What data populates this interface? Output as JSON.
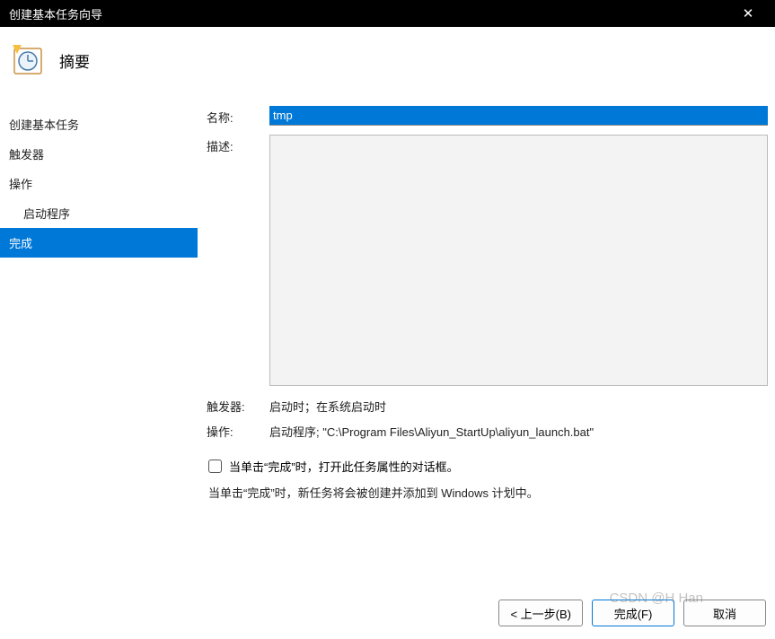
{
  "window": {
    "title": "创建基本任务向导"
  },
  "header": {
    "title": "摘要"
  },
  "sidebar": {
    "items": [
      {
        "label": "创建基本任务",
        "indent": false,
        "selected": false
      },
      {
        "label": "触发器",
        "indent": false,
        "selected": false
      },
      {
        "label": "操作",
        "indent": false,
        "selected": false
      },
      {
        "label": "启动程序",
        "indent": true,
        "selected": false
      },
      {
        "label": "完成",
        "indent": false,
        "selected": true
      }
    ]
  },
  "form": {
    "name_label": "名称:",
    "name_value": "tmp",
    "desc_label": "描述:",
    "desc_value": "",
    "trigger_label": "触发器:",
    "trigger_value": "启动时；在系统启动时",
    "action_label": "操作:",
    "action_value": "启动程序; \"C:\\Program Files\\Aliyun_StartUp\\aliyun_launch.bat\"",
    "checkbox_label": "当单击“完成”时，打开此任务属性的对话框。",
    "note": "当单击“完成”时，新任务将会被创建并添加到 Windows 计划中。"
  },
  "footer": {
    "back": "< 上一步(B)",
    "finish": "完成(F)",
    "cancel": "取消"
  },
  "watermark": "CSDN @H Han"
}
